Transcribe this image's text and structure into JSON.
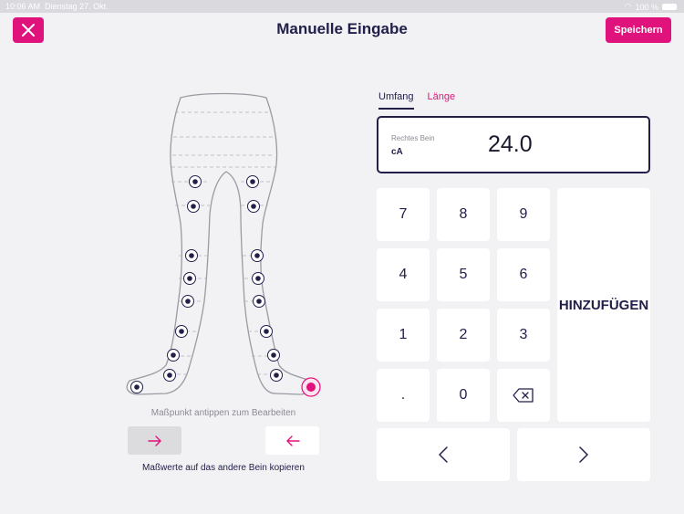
{
  "status": {
    "time": "10:06 AM",
    "date": "Dienstag 27. Okt.",
    "battery": "100 %"
  },
  "header": {
    "title": "Manuelle Eingabe",
    "save_label": "Speichern"
  },
  "diagram": {
    "hint": "Maßpunkt antippen zum Bearbeiten",
    "copy_label": "Maßwerte auf das andere Bein kopieren"
  },
  "tabs": [
    {
      "label": "Umfang",
      "active": true
    },
    {
      "label": "Länge",
      "active": false
    }
  ],
  "display": {
    "leg": "Rechtes Bein",
    "point": "cA",
    "value": "24.0"
  },
  "keypad": {
    "keys": [
      "7",
      "8",
      "9",
      "4",
      "5",
      "6",
      "1",
      "2",
      "3",
      ".",
      "0"
    ],
    "add_label": "HINZUFÜGEN"
  },
  "colors": {
    "accent": "#e0127c",
    "navy": "#22204a",
    "background": "#f2f2f4"
  }
}
